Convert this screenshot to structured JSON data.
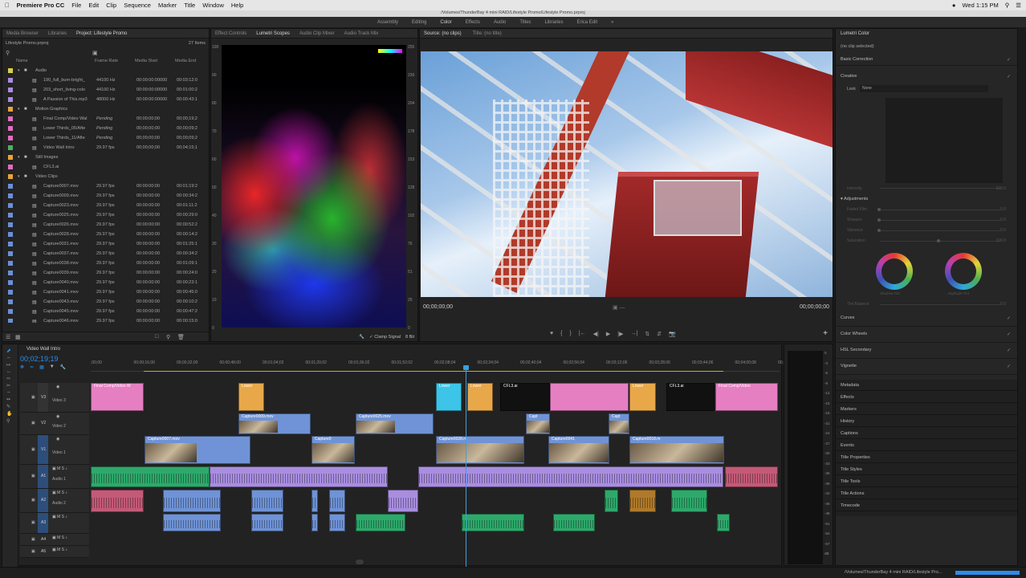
{
  "menubar": {
    "app": "Premiere Pro CC",
    "items": [
      "File",
      "Edit",
      "Clip",
      "Sequence",
      "Marker",
      "Title",
      "Window",
      "Help"
    ],
    "clock": "Wed 1:15 PM"
  },
  "window": {
    "path": "/Volumes/ThunderBay 4 mini RAID/Lifestyle Promo/Lifestyle Promo.prproj"
  },
  "workspaces": [
    "Assembly",
    "Editing",
    "Color",
    "Effects",
    "Audio",
    "Titles",
    "Libraries",
    "Erica Edit"
  ],
  "project": {
    "tabs": [
      "Media Browser",
      "Libraries",
      "Project: Lifestyle Promo"
    ],
    "file": "Lifestyle Promo.prproj",
    "item_count": "27 Items",
    "columns": [
      "Name",
      "Frame Rate",
      "Media Start",
      "Media End"
    ],
    "rows": [
      {
        "indent": 0,
        "name": "Audio",
        "rate": "",
        "start": "",
        "end": "",
        "color": "#d8cf4a",
        "bin": true
      },
      {
        "indent": 1,
        "name": "190_full_burn-bright_",
        "rate": "44100 Hz",
        "start": "00:00:00:00000",
        "end": "00:03:12:0",
        "color": "#a98be0"
      },
      {
        "indent": 1,
        "name": "203_short_living-colo",
        "rate": "44100 Hz",
        "start": "00:00:00:00000",
        "end": "00:01:00:2",
        "color": "#a98be0"
      },
      {
        "indent": 1,
        "name": "A Passion of This.mp3",
        "rate": "48000 Hz",
        "start": "00:00:00:00000",
        "end": "00:00:43:1",
        "color": "#a98be0"
      },
      {
        "indent": 0,
        "name": "Motion Graphics",
        "rate": "",
        "start": "",
        "end": "",
        "color": "#e8a33a",
        "bin": true
      },
      {
        "indent": 1,
        "name": "Final Comp/Video Wal",
        "rate": "Pending",
        "start": "00;00;00;00",
        "end": "00;00;19;2",
        "color": "#e06cc0"
      },
      {
        "indent": 1,
        "name": "Lower Thirds_05/Afte",
        "rate": "Pending",
        "start": "00;00;00;00",
        "end": "00;00;09;2",
        "color": "#e06cc0"
      },
      {
        "indent": 1,
        "name": "Lower Thirds_11/Afte",
        "rate": "Pending",
        "start": "00;00;00;00",
        "end": "00;00;09;2",
        "color": "#e06cc0"
      },
      {
        "indent": 1,
        "name": "Video Wall Intro",
        "rate": "29.97 fps",
        "start": "00;00;00;00",
        "end": "00;04;15;1",
        "color": "#4fb060"
      },
      {
        "indent": 0,
        "name": "Still Images",
        "rate": "",
        "start": "",
        "end": "",
        "color": "#e8a33a",
        "bin": true
      },
      {
        "indent": 1,
        "name": "CFL3.ai",
        "rate": "",
        "start": "",
        "end": "",
        "color": "#e06cc0"
      },
      {
        "indent": 0,
        "name": "Video Clips",
        "rate": "",
        "start": "",
        "end": "",
        "color": "#e8a33a",
        "bin": true
      },
      {
        "indent": 1,
        "name": "Capture0007.mov",
        "rate": "29.97 fps",
        "start": "00:00:00:00",
        "end": "00:01:19:2",
        "color": "#6a8fd6"
      },
      {
        "indent": 1,
        "name": "Capture0009.mov",
        "rate": "29.97 fps",
        "start": "00:00:00:00",
        "end": "00:00:34:2",
        "color": "#6a8fd6"
      },
      {
        "indent": 1,
        "name": "Capture0023.mov",
        "rate": "29.97 fps",
        "start": "00:00:00:00",
        "end": "00:01:11:2",
        "color": "#6a8fd6"
      },
      {
        "indent": 1,
        "name": "Capture0025.mov",
        "rate": "29.97 fps",
        "start": "00:00:00:00",
        "end": "00:00:29:0",
        "color": "#6a8fd6"
      },
      {
        "indent": 1,
        "name": "Capture0026.mov",
        "rate": "29.97 fps",
        "start": "00:00:00:00",
        "end": "00:00:52:2",
        "color": "#6a8fd6"
      },
      {
        "indent": 1,
        "name": "Capture0028.mov",
        "rate": "29.97 fps",
        "start": "00:00:00:00",
        "end": "00:00:14:2",
        "color": "#6a8fd6"
      },
      {
        "indent": 1,
        "name": "Capture0031.mov",
        "rate": "29.97 fps",
        "start": "00:00:00:00",
        "end": "00:01:25:1",
        "color": "#6a8fd6"
      },
      {
        "indent": 1,
        "name": "Capture0037.mov",
        "rate": "29.97 fps",
        "start": "00:00:00:00",
        "end": "00:00:34:2",
        "color": "#6a8fd6"
      },
      {
        "indent": 1,
        "name": "Capture0038.mov",
        "rate": "29.97 fps",
        "start": "00:00:00:00",
        "end": "00:01:09:1",
        "color": "#6a8fd6"
      },
      {
        "indent": 1,
        "name": "Capture0039.mov",
        "rate": "29.97 fps",
        "start": "00:00:00:00",
        "end": "00:00:24:0",
        "color": "#6a8fd6"
      },
      {
        "indent": 1,
        "name": "Capture0040.mov",
        "rate": "29.97 fps",
        "start": "00:00:00:00",
        "end": "00:00:23:1",
        "color": "#6a8fd6"
      },
      {
        "indent": 1,
        "name": "Capture0041.mov",
        "rate": "29.97 fps",
        "start": "00:00:00:00",
        "end": "00:00:45:0",
        "color": "#6a8fd6"
      },
      {
        "indent": 1,
        "name": "Capture0043.mov",
        "rate": "29.97 fps",
        "start": "00:00:00:00",
        "end": "00:00:10:2",
        "color": "#6a8fd6"
      },
      {
        "indent": 1,
        "name": "Capture0045.mov",
        "rate": "29.97 fps",
        "start": "00:00:00:00",
        "end": "00:00:47:2",
        "color": "#6a8fd6"
      },
      {
        "indent": 1,
        "name": "Capture0046.mov",
        "rate": "29.97 fps",
        "start": "00:00:00:00",
        "end": "00:00:15:0",
        "color": "#6a8fd6"
      }
    ]
  },
  "scopes": {
    "tabs": [
      "Effect Controls",
      "Lumetri Scopes",
      "Audio Clip Mixer",
      "Audio Track Mix"
    ],
    "left_scale": [
      "100",
      "90",
      "80",
      "70",
      "60",
      "50",
      "40",
      "30",
      "20",
      "10",
      "0"
    ],
    "right_scale": [
      "255",
      "230",
      "204",
      "178",
      "153",
      "128",
      "102",
      "76",
      "51",
      "25",
      "0"
    ],
    "clamp": "Clamp Signal",
    "bits": "8 Bit"
  },
  "source": {
    "tabs": [
      "Source: (no clips)",
      "Title: (no title)"
    ],
    "tc_left": "00;00;00;00",
    "tc_right": "00;00;00;00"
  },
  "lumetri": {
    "title": "Lumetri Color",
    "clip": "(no clip selected)",
    "basic": "Basic Correction",
    "creative": "Creative",
    "look_label": "Look",
    "look_value": "None",
    "intensity": "Intensity",
    "intensity_val": "100.0",
    "adjustments": "Adjustments",
    "sliders": [
      {
        "label": "Faded Film",
        "val": "0.0"
      },
      {
        "label": "Sharpen",
        "val": "0.0"
      },
      {
        "label": "Vibrance",
        "val": "0.0"
      },
      {
        "label": "Saturation",
        "val": "100.0"
      }
    ],
    "wheel1": "Shadow Tint",
    "wheel2": "Highlight Tint",
    "tint_balance": "Tint Balance",
    "tint_val": "0.0",
    "sections": [
      "Curves",
      "Color Wheels",
      "HSL Secondary",
      "Vignette"
    ],
    "panels": [
      "Metadata",
      "Effects",
      "Markers",
      "History",
      "Captions",
      "Events",
      "Title Properties",
      "Title Styles",
      "Title Tools",
      "Title Actions",
      "Timecode"
    ]
  },
  "timeline": {
    "name": "Video Wall Intro",
    "timecode": "00;02;19;19",
    "ruler": [
      ";00;00",
      "00;00;16;00",
      "00;00;32;00",
      "00;00;48;00",
      "00;01;04;02",
      "00;01;20;02",
      "00;01;36;02",
      "00;01;52;02",
      "00;02;08;04",
      "00;02;24;04",
      "00;02;40;04",
      "00;02;56;04",
      "00;03;12;06",
      "00;03;28;06",
      "00;03;44;06",
      "00;04;00;08",
      "00;0"
    ],
    "tracks": [
      "V3",
      "V2",
      "V1",
      "A1",
      "A2",
      "A3",
      "A4",
      "A5"
    ],
    "track_names": {
      "v3": "Video 3",
      "v2": "Video 2",
      "v1": "Video 1",
      "a1": "Audio 1",
      "a2": "Audio 2"
    },
    "clips": {
      "final_comp": "Final Comp/Video W",
      "lower": "Lower",
      "cfl3": "CFL3.ai",
      "final_comp2": "Final Comp/Video",
      "c0009": "Capture0009.mov",
      "c0025": "Capture0025.mov",
      "capt": "Capt",
      "c0007": "Capture0007.mov",
      "c0031": "Capture0",
      "c0028": "Capture0028.m",
      "c0041": "Capture0041",
      "c0018": "Capture0018.m",
      "c003": "Capture03"
    },
    "meter_scale": [
      "0",
      "-3",
      "-6",
      "-9",
      "-12",
      "-15",
      "-18",
      "-21",
      "-24",
      "-27",
      "-30",
      "-33",
      "-36",
      "-39",
      "-42",
      "-45",
      "-48",
      "-51",
      "-54",
      "-57",
      "dB"
    ]
  },
  "statusbar": {
    "path": "/Volumes/ThunderBay 4 mini RAID/Lifestyle Pro..."
  },
  "colors": {
    "accent": "#2d8ceb",
    "playhead": "#3a9fe0",
    "magenta": "#e57fc2",
    "orange": "#e8a84a",
    "blue_clip": "#6f93d6",
    "audio_green": "#2ea96b",
    "audio_purple": "#a98ee0",
    "audio_red": "#c45a78"
  }
}
